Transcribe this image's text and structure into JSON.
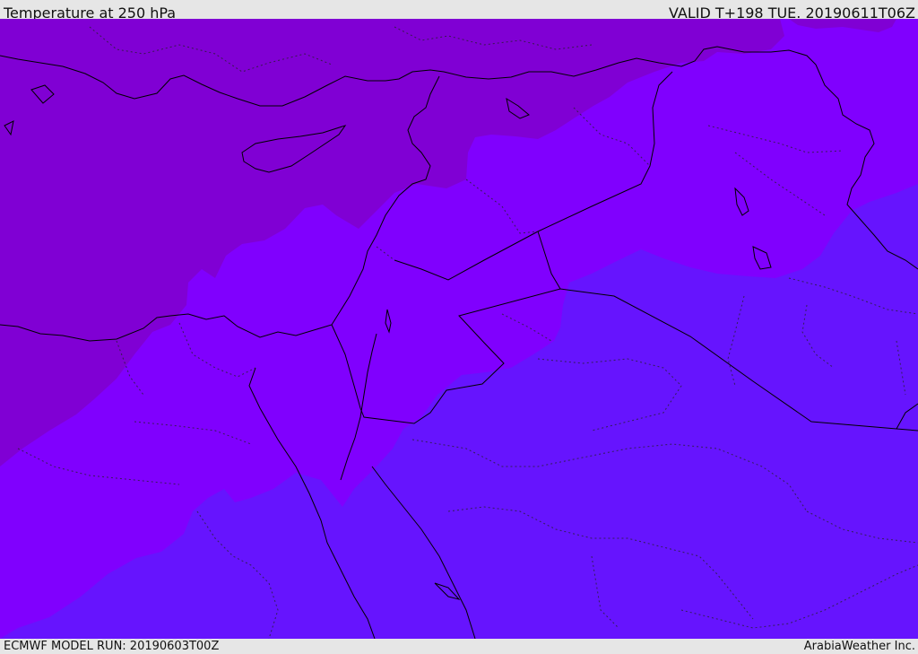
{
  "header": {
    "title": "Temperature at 250 hPa",
    "valid_time": "VALID T+198 TUE. 20190611T06Z"
  },
  "footer": {
    "model_run": "ECMWF MODEL RUN: 20190603T00Z",
    "credit": "ArabiaWeather Inc."
  },
  "map": {
    "field": "Temperature at 250 hPa",
    "bands": [
      {
        "name": "coldest",
        "color": "#8000d4"
      },
      {
        "name": "middle",
        "color": "#8000fe"
      },
      {
        "name": "warmest",
        "color": "#6614fe"
      }
    ],
    "coastline_color": "#000000",
    "border_style": "dotted"
  }
}
